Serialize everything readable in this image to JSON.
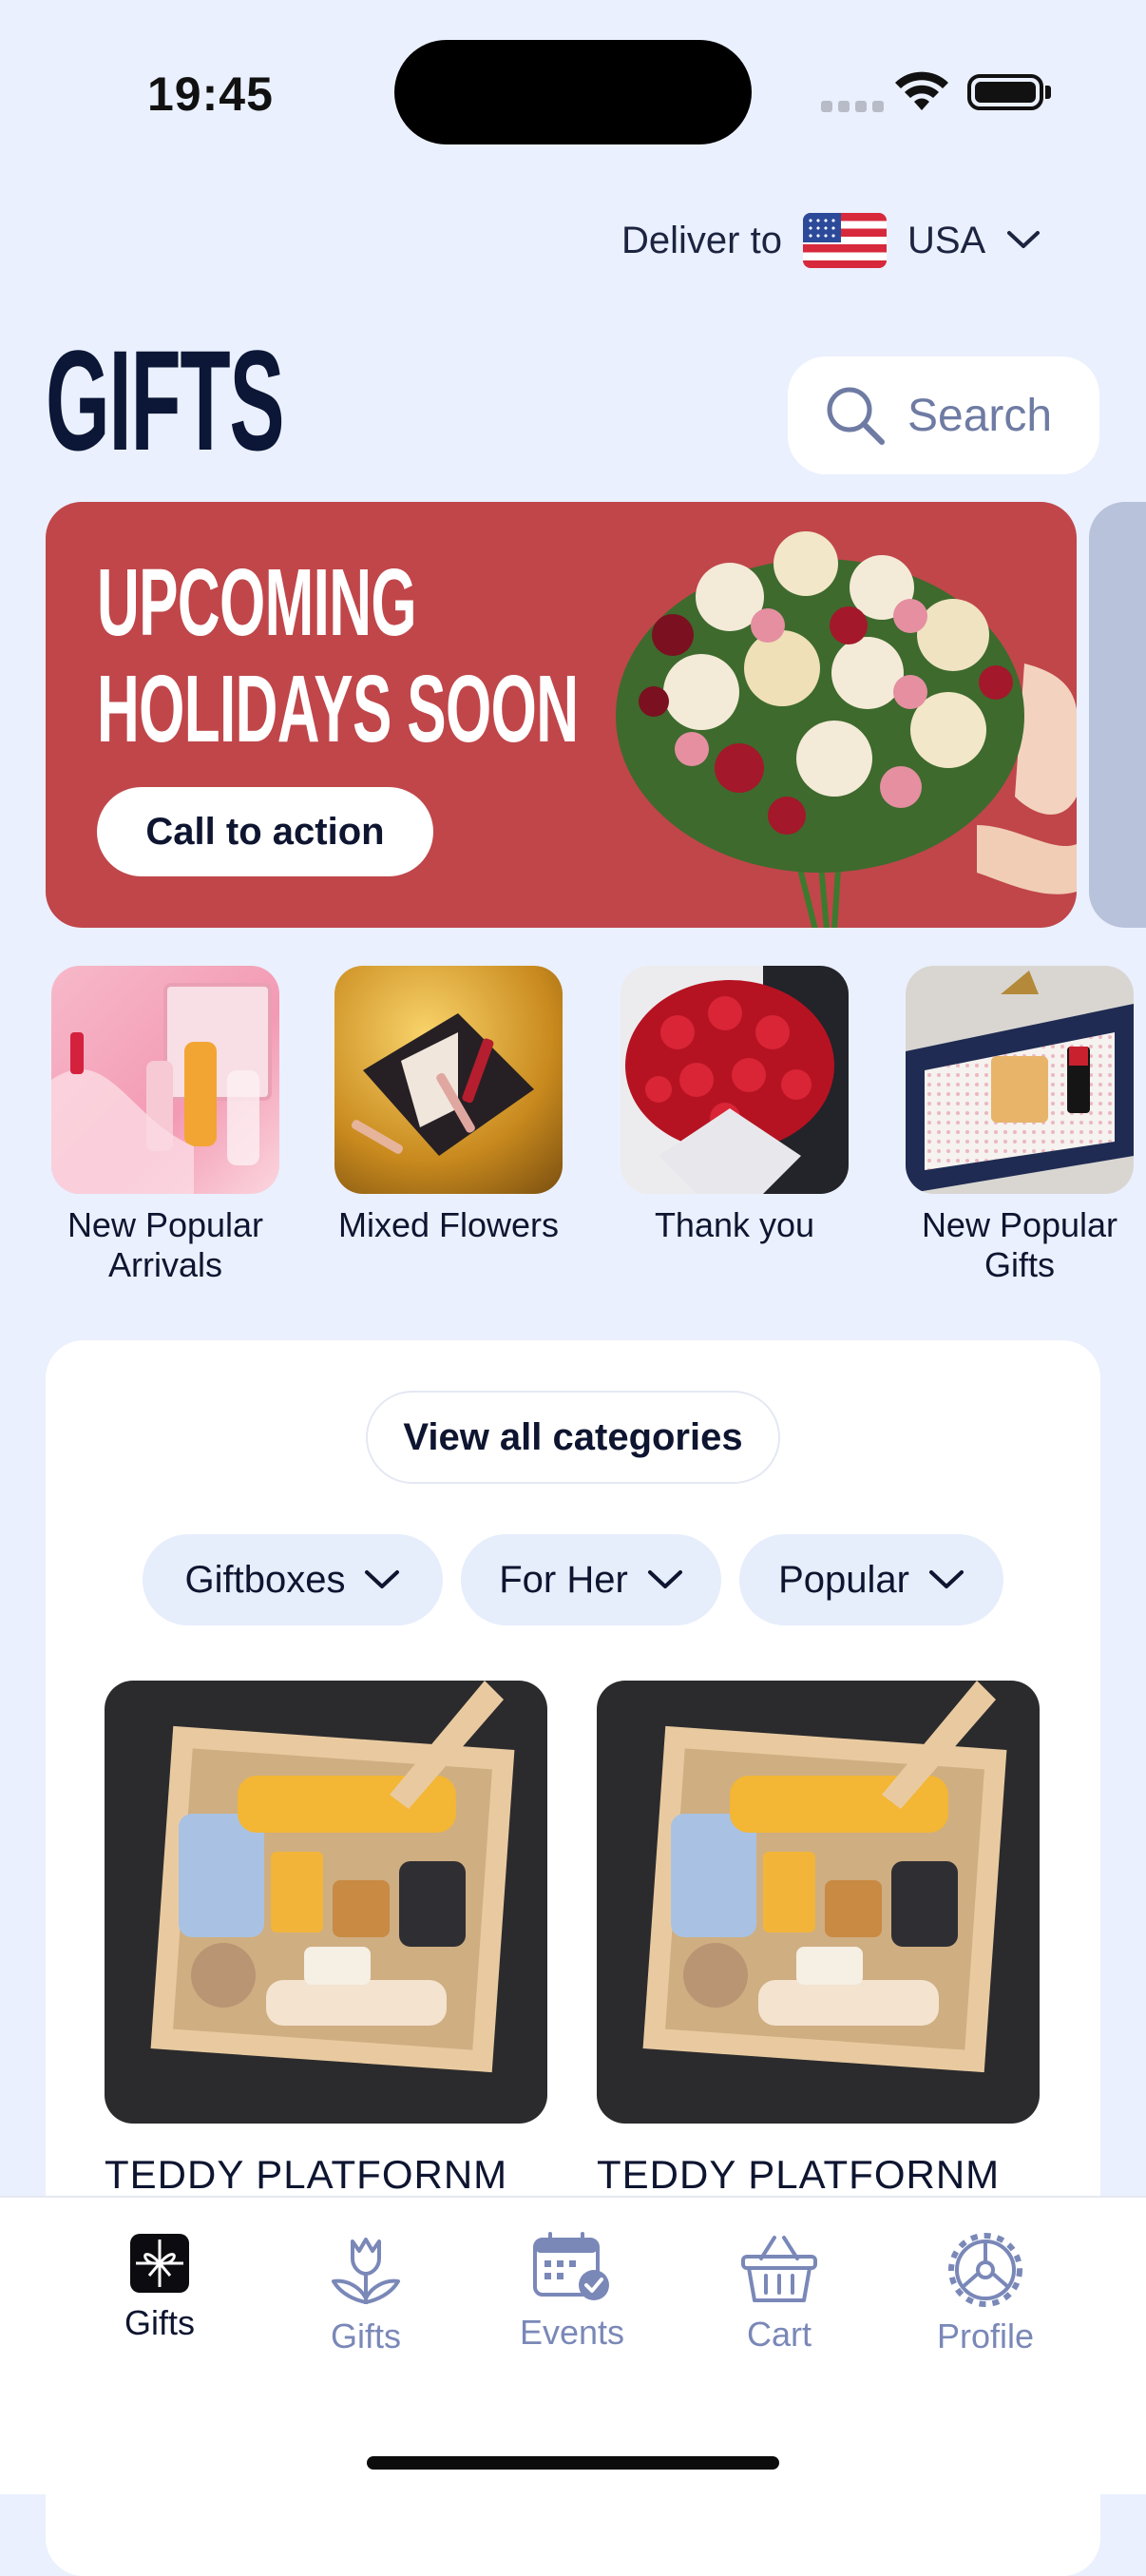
{
  "status_bar": {
    "time": "19:45"
  },
  "header": {
    "deliver_label": "Deliver to",
    "country": "USA",
    "title": "GIFTS",
    "search_label": "Search"
  },
  "banner": {
    "title_line1": "UPCOMING",
    "title_line2": "HOLIDAYS SOON",
    "cta_label": "Call to action"
  },
  "categories": [
    {
      "label_line1": "New Popular",
      "label_line2": "Arrivals"
    },
    {
      "label_line1": "Mixed Flowers",
      "label_line2": ""
    },
    {
      "label_line1": "Thank you",
      "label_line2": ""
    },
    {
      "label_line1": "New Popular",
      "label_line2": "Gifts"
    }
  ],
  "catalog": {
    "view_all_label": "View all categories",
    "filters": [
      "Giftboxes",
      "For Her",
      "Popular"
    ],
    "products": [
      {
        "title": "TEDDY PLATFORNM"
      },
      {
        "title": "TEDDY PLATFORNM"
      }
    ]
  },
  "tabbar": {
    "items": [
      {
        "label": "Gifts",
        "icon": "gift-box-icon",
        "active": true
      },
      {
        "label": "Gifts",
        "icon": "tulip-icon",
        "active": false
      },
      {
        "label": "Events",
        "icon": "calendar-check-icon",
        "active": false
      },
      {
        "label": "Cart",
        "icon": "basket-icon",
        "active": false
      },
      {
        "label": "Profile",
        "icon": "profile-gear-icon",
        "active": false
      }
    ]
  },
  "colors": {
    "background": "#eaf0fd",
    "banner": "#c0464a",
    "title": "#0c1636",
    "tab_inactive": "#7a88b8"
  }
}
